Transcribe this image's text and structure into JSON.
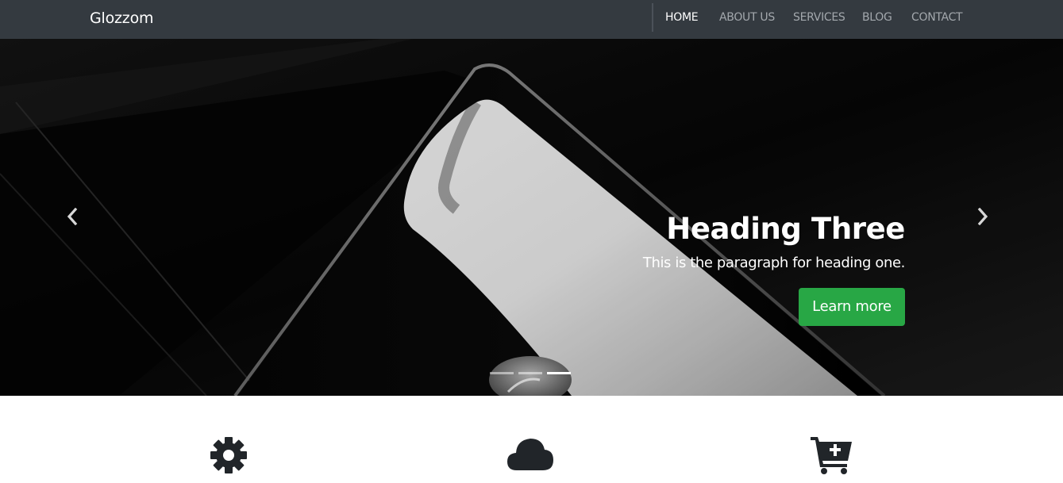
{
  "navbar": {
    "brand": "Glozzom",
    "links": [
      {
        "label": "HOME",
        "active": true
      },
      {
        "label": "ABOUT US",
        "active": false
      },
      {
        "label": "SERVICES",
        "active": false
      },
      {
        "label": "BLOG",
        "active": false
      },
      {
        "label": "CONTACT",
        "active": false
      }
    ]
  },
  "carousel": {
    "caption": {
      "title": "Heading Three",
      "text": "This is the paragraph for heading one.",
      "button_label": "Learn more"
    },
    "slide_count": 3,
    "active_slide": 3,
    "controls": {
      "prev_icon": "chevron-left-icon",
      "next_icon": "chevron-right-icon"
    }
  },
  "features": {
    "icons": [
      "gear-icon",
      "cloud-icon",
      "cart-plus-icon"
    ]
  },
  "colors": {
    "navbar_bg": "#343a40",
    "nav_active": "#ffffff",
    "nav_inactive": "#a3a8ad",
    "button_bg": "#28a745",
    "icon_color": "#212529"
  }
}
